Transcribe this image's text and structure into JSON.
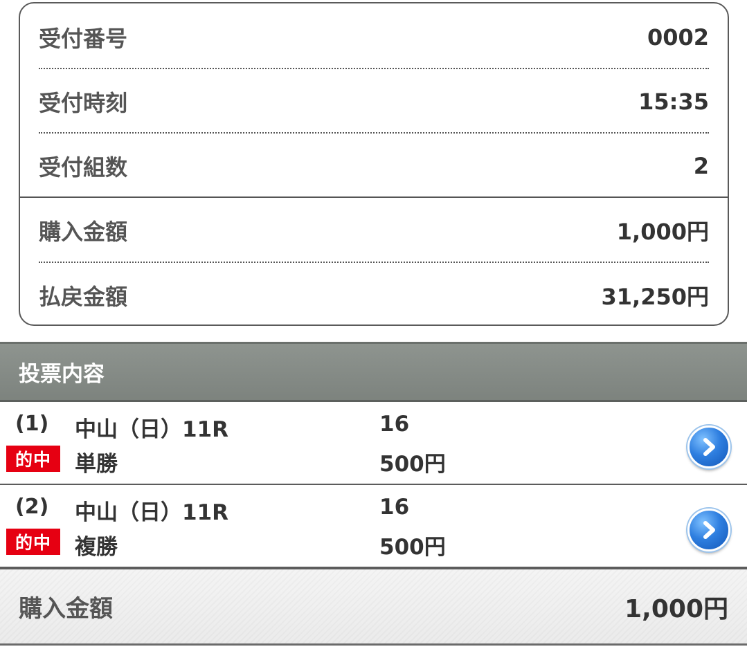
{
  "summary": {
    "rows": [
      {
        "label": "受付番号",
        "value": "0002"
      },
      {
        "label": "受付時刻",
        "value": "15:35"
      },
      {
        "label": "受付組数",
        "value": "2"
      },
      {
        "label": "購入金額",
        "value": "1,000円"
      },
      {
        "label": "払戻金額",
        "value": "31,250円"
      }
    ]
  },
  "section": {
    "title": "投票内容"
  },
  "bets": [
    {
      "number": "(1)",
      "badge": "的中",
      "race": "中山（日）11R",
      "type": "単勝",
      "horse": "16",
      "amount": "500円",
      "icon": "chevron-right-circle-icon"
    },
    {
      "number": "(2)",
      "badge": "的中",
      "race": "中山（日）11R",
      "type": "複勝",
      "horse": "16",
      "amount": "500円",
      "icon": "chevron-right-circle-icon"
    }
  ],
  "total": {
    "label": "購入金額",
    "value": "1,000円"
  },
  "colors": {
    "hit_badge": "#e60012",
    "header_bg": "#858b86",
    "arrow_blue": "#2f7fe0"
  }
}
